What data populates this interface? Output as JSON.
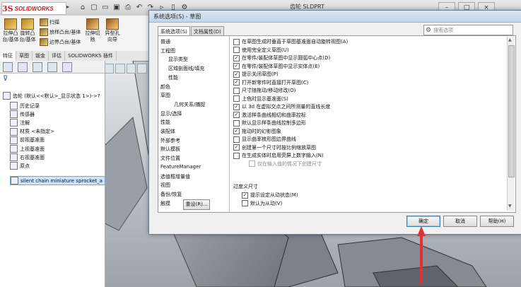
{
  "app": {
    "logo_mark": "3S",
    "logo_text": "SOLIDWORKS",
    "doc_title": "齿轮 SLDPRT",
    "toolbar_glyphs": [
      "⌂",
      "▢",
      "▭",
      "▣",
      "⎙",
      "↶",
      "↷",
      "▹",
      "▯",
      "⚙"
    ]
  },
  "ribbon": {
    "buttons": [
      {
        "label": "拉伸凸\n台/基体",
        "color": "#b8860b"
      },
      {
        "label": "旋转凸\n台/基体",
        "color": "#b8860b"
      },
      {
        "label": "扫描",
        "color": "#8a6d3b"
      },
      {
        "label": "放样凸台/基体",
        "color": "#8a6d3b"
      },
      {
        "label": "边界凸台/基体",
        "color": "#8a6d3b"
      },
      {
        "label": "拉伸切\n除",
        "color": "#a05020"
      },
      {
        "label": "异型孔\n向导",
        "color": "#a05020"
      }
    ]
  },
  "tabs": [
    "特征",
    "草图",
    "钣金",
    "评估",
    "SOLIDWORKS 插件"
  ],
  "tree": {
    "root": "齿轮 (默认<<默认>_显示状态 1>)->?",
    "items": [
      "历史记录",
      "传感器",
      "注解",
      "材质 <未指定>",
      "前视基准面",
      "上视基准面",
      "右视基准面",
      "原点"
    ],
    "selected": "silent chain miniature sprocket_a"
  },
  "dialog": {
    "title": "系统选项(S) - 草图",
    "tabs": [
      "系统选项(S)",
      "文档属性(D)"
    ],
    "search_placeholder": "搜索选项",
    "categories": [
      {
        "label": "普通",
        "level": 0
      },
      {
        "label": "工程图",
        "level": 0
      },
      {
        "label": "显示类型",
        "level": 1
      },
      {
        "label": "区域剖面线/填充",
        "level": 1
      },
      {
        "label": "性能",
        "level": 1
      },
      {
        "label": "颜色",
        "level": 0
      },
      {
        "label": "草图",
        "level": 0
      },
      {
        "label": "几何关系/捕捉",
        "level": 2
      },
      {
        "label": "显示/选择",
        "level": 0
      },
      {
        "label": "性能",
        "level": 0
      },
      {
        "label": "装配体",
        "level": 0
      },
      {
        "label": "外部参考",
        "level": 0
      },
      {
        "label": "默认模板",
        "level": 0
      },
      {
        "label": "文件位置",
        "level": 0
      },
      {
        "label": "FeatureManager",
        "level": 0
      },
      {
        "label": "选值框增量值",
        "level": 0
      },
      {
        "label": "视图",
        "level": 0
      },
      {
        "label": "备份/恢复",
        "level": 0
      },
      {
        "label": "触摸",
        "level": 0
      }
    ],
    "options": [
      {
        "label": "在草图生成时垂直于草图基准面自动旋转视图(A)",
        "checked": false,
        "indent": 0
      },
      {
        "label": "使用完全定义草图(U)",
        "checked": false,
        "indent": 0
      },
      {
        "label": "在零件/装配体草图中显示圆弧中心点(D)",
        "checked": true,
        "indent": 0
      },
      {
        "label": "在零件/装配体草图中显示实体点(E)",
        "checked": true,
        "indent": 0
      },
      {
        "label": "提示关闭草图(P)",
        "checked": true,
        "indent": 0
      },
      {
        "label": "打开新零件时直接打开草图(C)",
        "checked": true,
        "indent": 0
      },
      {
        "label": "尺寸随拖动/移动修改(O)",
        "checked": false,
        "indent": 0
      },
      {
        "label": "上色时显示基准面(S)",
        "checked": false,
        "indent": 0
      },
      {
        "label": "以 3d 在虚拟交点之间所测量的直线长度",
        "checked": true,
        "indent": 0
      },
      {
        "label": "激活样条曲线相切和曲率控标",
        "checked": true,
        "indent": 0
      },
      {
        "label": "默认显示样条曲线控制多边形",
        "checked": false,
        "indent": 0
      },
      {
        "label": "拖动时的幻影图象",
        "checked": true,
        "indent": 0
      },
      {
        "label": "显示曲率梳形图边界曲线",
        "checked": false,
        "indent": 0
      },
      {
        "label": "创建第一个尺寸时按比例缩放草图",
        "checked": true,
        "indent": 0
      },
      {
        "label": "在生成实体时启用荧屏上数字输入(N)",
        "checked": false,
        "indent": 0
      },
      {
        "label": "仅在输入值的情况下创建尺寸",
        "checked": false,
        "indent": 2,
        "disabled": true
      }
    ],
    "group_label": "过度义尺寸",
    "group_options": [
      {
        "label": "提示设定从动状态(M)",
        "checked": true
      },
      {
        "label": "默认为从动(V)",
        "checked": false
      }
    ],
    "reset_label": "重设(R)...",
    "ok_label": "确定",
    "cancel_label": "取消",
    "help_label": "帮助(H)"
  },
  "colors": {
    "annotation_arrow": "#e53030",
    "dialog_titlebar": "#c3d4ea",
    "ok_border": "#3c7fb1"
  }
}
